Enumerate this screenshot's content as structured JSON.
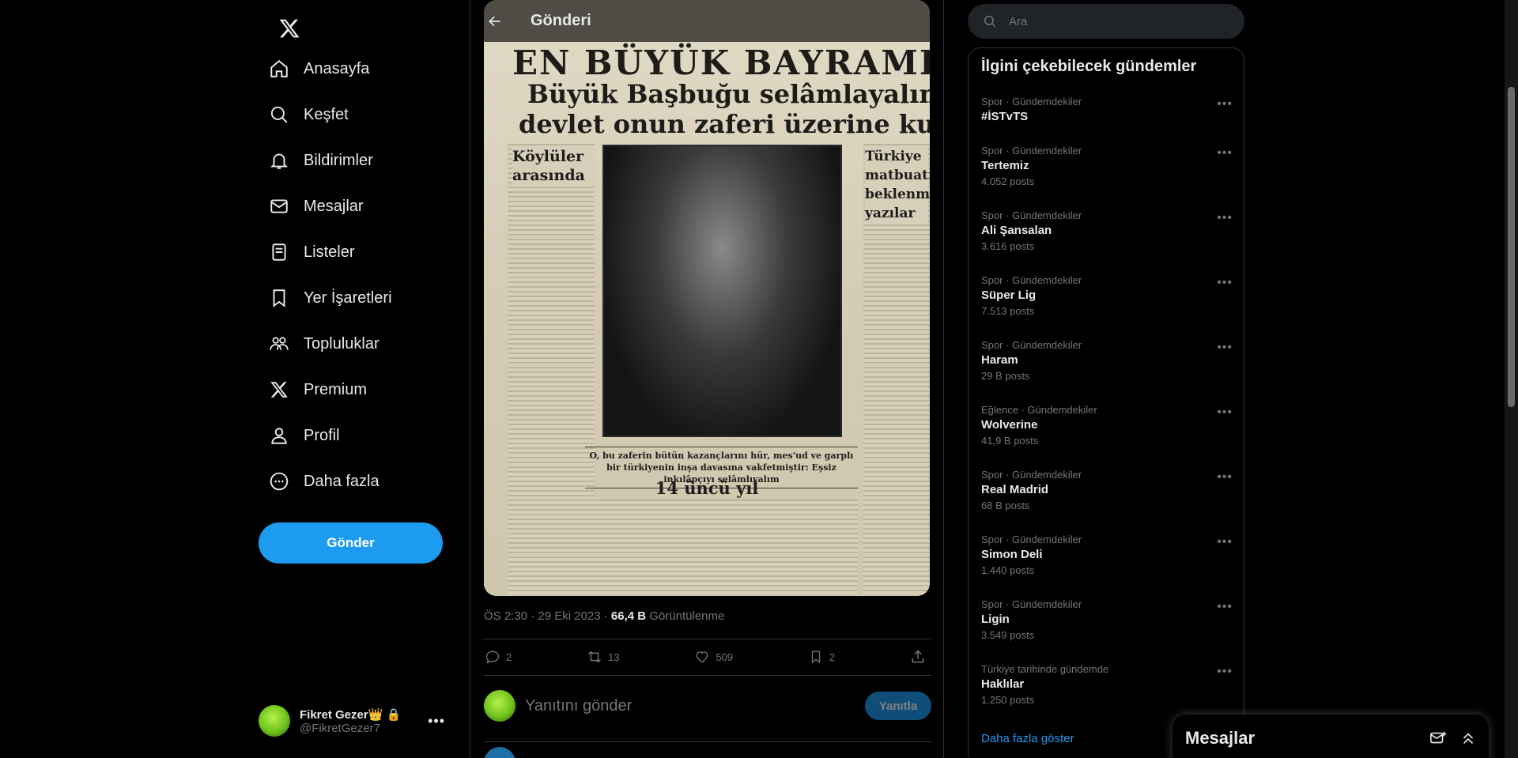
{
  "nav": {
    "items": [
      {
        "label": "Anasayfa",
        "icon": "home-icon"
      },
      {
        "label": "Keşfet",
        "icon": "search-icon"
      },
      {
        "label": "Bildirimler",
        "icon": "bell-icon"
      },
      {
        "label": "Mesajlar",
        "icon": "envelope-icon"
      },
      {
        "label": "Listeler",
        "icon": "list-icon"
      },
      {
        "label": "Yer İşaretleri",
        "icon": "bookmark-icon"
      },
      {
        "label": "Topluluklar",
        "icon": "communities-icon"
      },
      {
        "label": "Premium",
        "icon": "x-logo-icon"
      },
      {
        "label": "Profil",
        "icon": "person-icon"
      },
      {
        "label": "Daha fazla",
        "icon": "more-circle-icon"
      }
    ],
    "post_button": "Gönder"
  },
  "account": {
    "name": "Fikret Gezer👑",
    "handle": "@FikretGezer7"
  },
  "main": {
    "title": "Gönderi",
    "newspaper": {
      "headline1": "EN BÜYÜK BAYRAMIMIZ",
      "headline2": "Büyük Başbuğu selâmlayalım. Bu",
      "headline3": "devlet onun zaferi üzerine kuruldu",
      "left_head": "Köylüler arasında",
      "right_head": "Türkiye matbuatı beklenmiy yazılar",
      "caption": "O, bu zaferin bütün kazançlarını hür, mes'ud ve garplı bir türkiyenin inşa davasına vakfetmiştir: Eşsiz inkılâpçıyı selâmlıyalım",
      "subhead": "14 üncü yıl"
    },
    "meta": {
      "time": "ÖS 2:30 · 29 Eki 2023 · ",
      "views": "66,4 B",
      "views_label": " Görüntülenme"
    },
    "actions": {
      "replies": "2",
      "reposts": "13",
      "likes": "509",
      "bookmarks": "2"
    },
    "reply": {
      "placeholder": "Yanıtını gönder",
      "button": "Yanıtla"
    }
  },
  "search": {
    "placeholder": "Ara"
  },
  "trends": {
    "title": "İlgini çekebilecek gündemler",
    "items": [
      {
        "context": "Spor · Gündemdekiler",
        "name": "#İSTvTS",
        "count": ""
      },
      {
        "context": "Spor · Gündemdekiler",
        "name": "Tertemiz",
        "count": "4.052 posts"
      },
      {
        "context": "Spor · Gündemdekiler",
        "name": "Ali Şansalan",
        "count": "3.616 posts"
      },
      {
        "context": "Spor · Gündemdekiler",
        "name": "Süper Lig",
        "count": "7.513 posts"
      },
      {
        "context": "Spor · Gündemdekiler",
        "name": "Haram",
        "count": "29 B posts"
      },
      {
        "context": "Eğlence · Gündemdekiler",
        "name": "Wolverine",
        "count": "41,9 B posts"
      },
      {
        "context": "Spor · Gündemdekiler",
        "name": "Real Madrid",
        "count": "68 B posts"
      },
      {
        "context": "Spor · Gündemdekiler",
        "name": "Simon Deli",
        "count": "1.440 posts"
      },
      {
        "context": "Spor · Gündemdekiler",
        "name": "Ligin",
        "count": "3.549 posts"
      },
      {
        "context": "Türkiye tarihinde gündemde",
        "name": "Haklılar",
        "count": "1.250 posts"
      }
    ],
    "show_more": "Daha fazla göster"
  },
  "messages": {
    "title": "Mesajlar"
  },
  "colors": {
    "accent": "#1d9bf0",
    "background": "#000000",
    "muted": "#71767b",
    "border": "#2f3336"
  }
}
